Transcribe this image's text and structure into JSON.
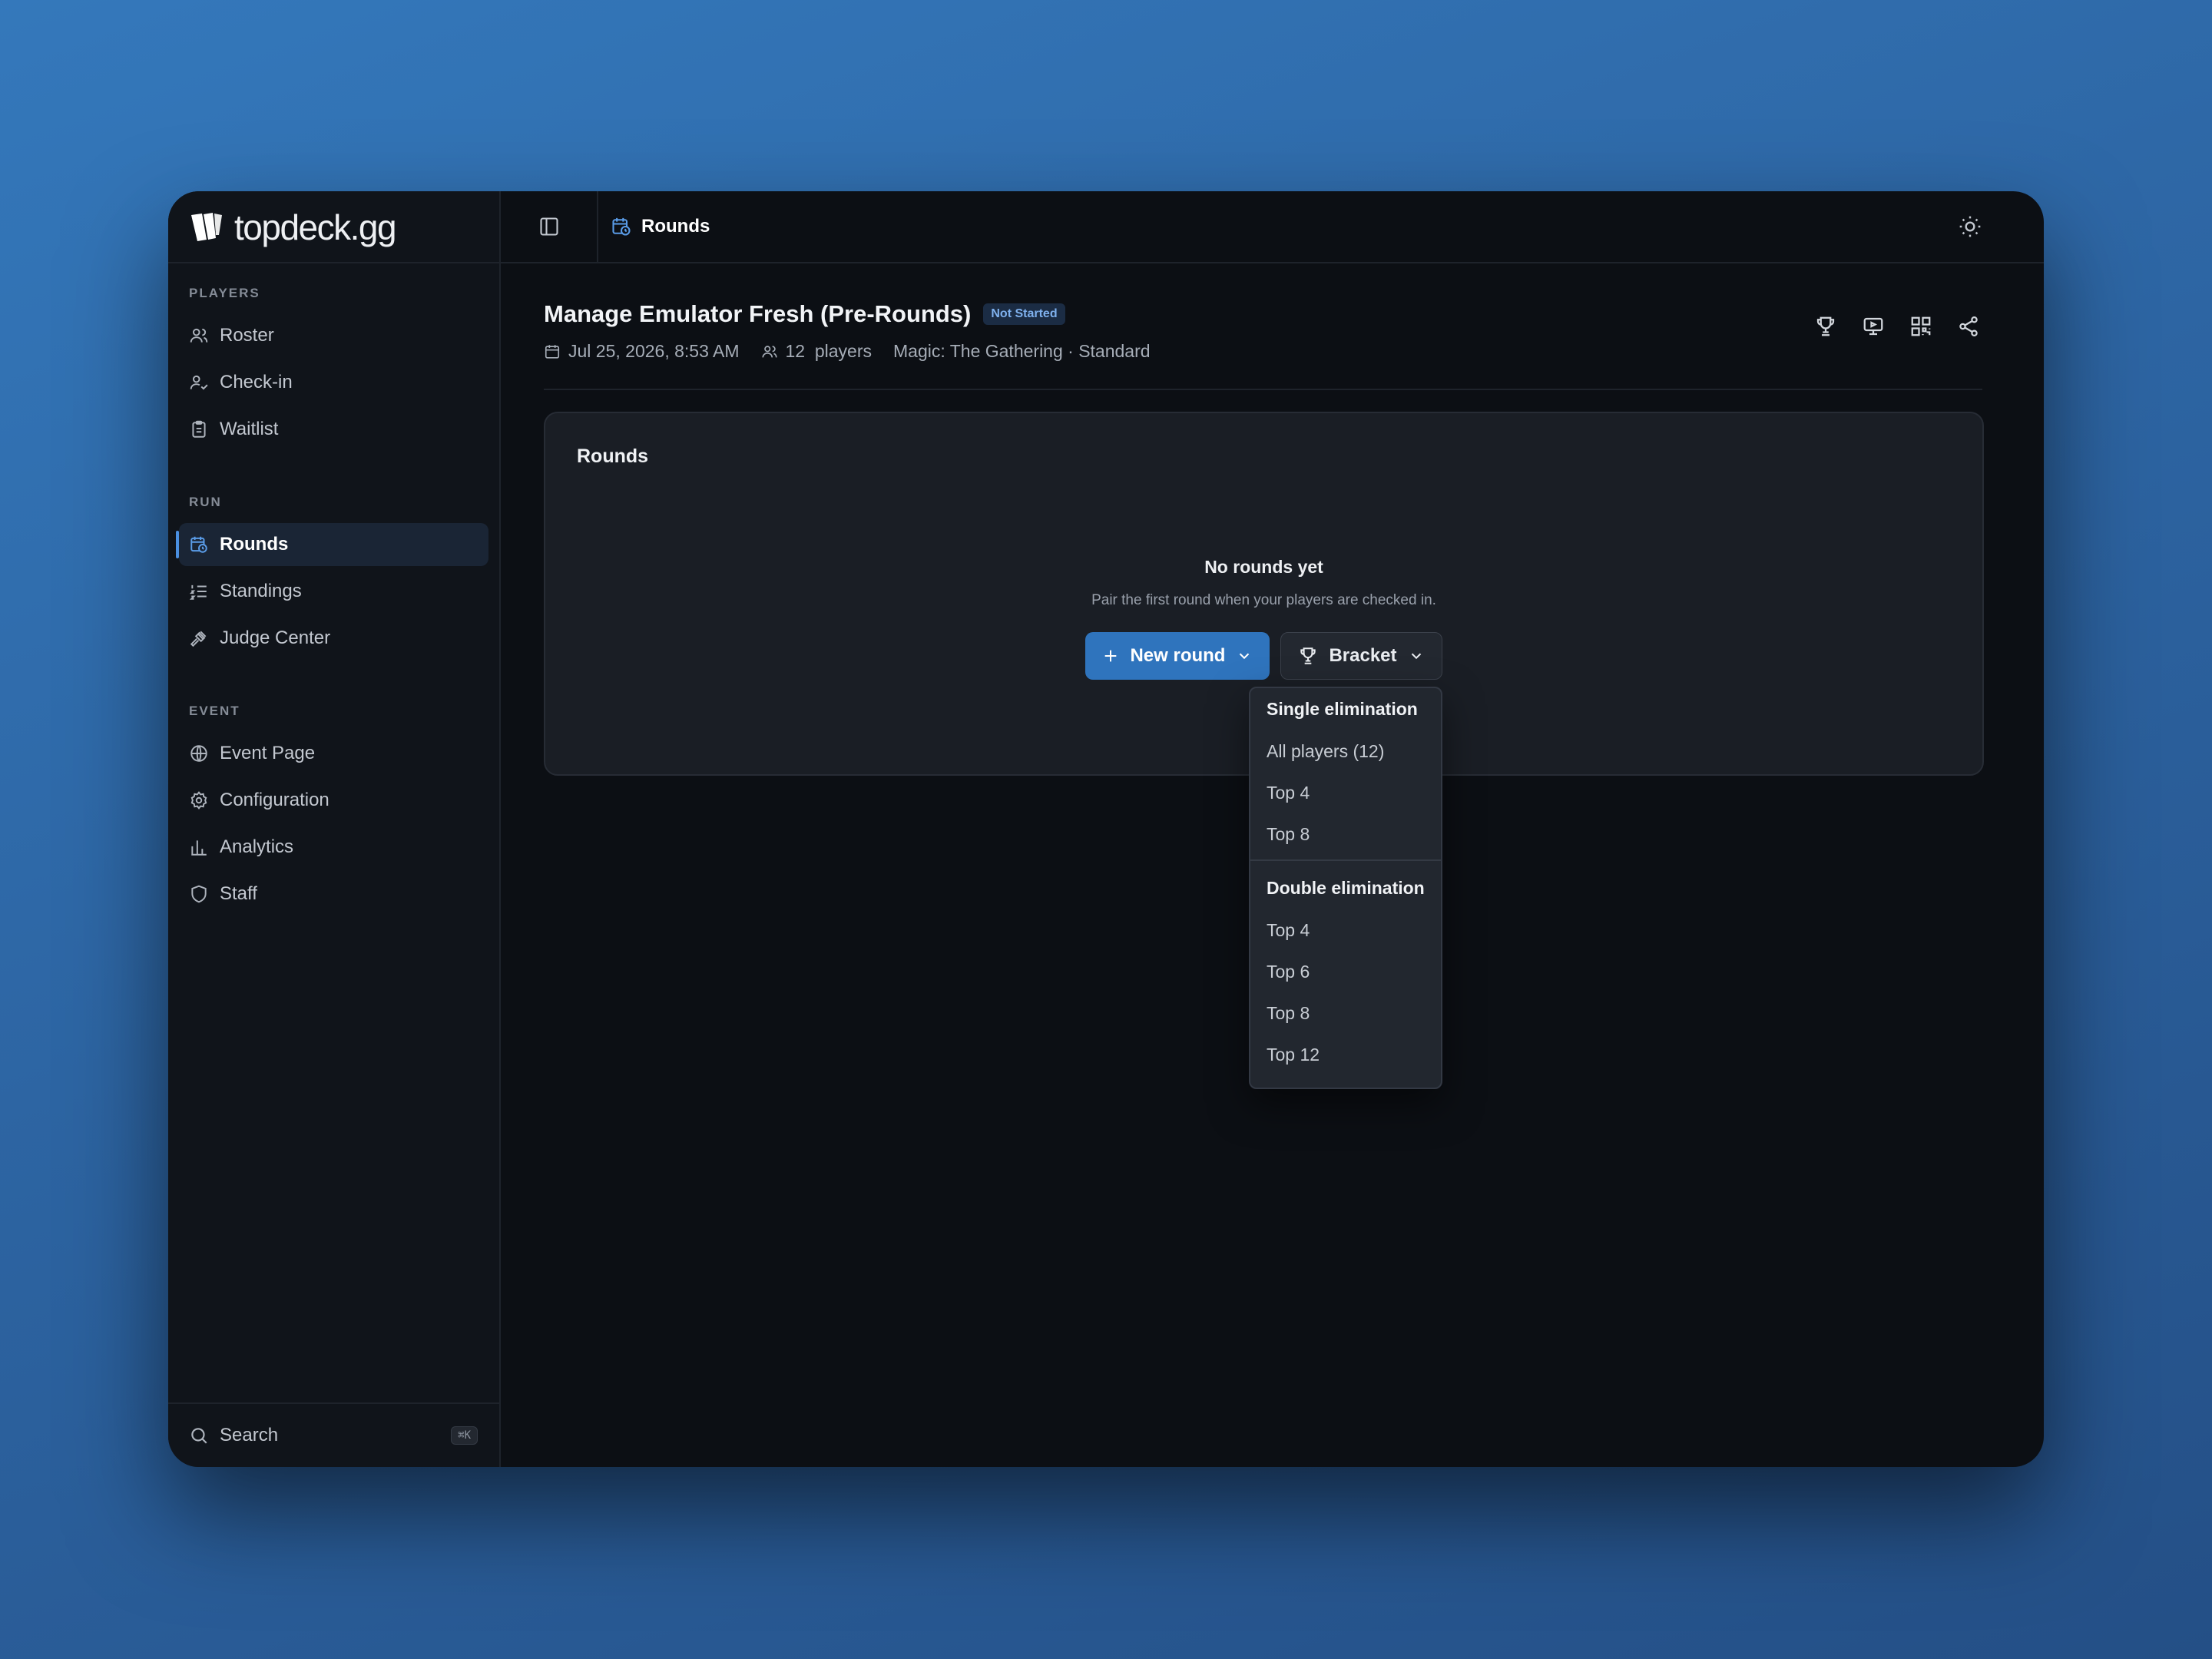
{
  "brand": {
    "name": "topdeck.gg"
  },
  "sidebar": {
    "sections": [
      {
        "label": "PLAYERS",
        "items": [
          {
            "label": "Roster",
            "icon": "users-icon"
          },
          {
            "label": "Check-in",
            "icon": "user-check-icon"
          },
          {
            "label": "Waitlist",
            "icon": "clipboard-icon"
          }
        ]
      },
      {
        "label": "RUN",
        "items": [
          {
            "label": "Rounds",
            "icon": "calendar-clock-icon",
            "active": true
          },
          {
            "label": "Standings",
            "icon": "list-ordered-icon"
          },
          {
            "label": "Judge Center",
            "icon": "gavel-icon"
          }
        ]
      },
      {
        "label": "EVENT",
        "items": [
          {
            "label": "Event Page",
            "icon": "globe-icon"
          },
          {
            "label": "Configuration",
            "icon": "gear-icon"
          },
          {
            "label": "Analytics",
            "icon": "bar-chart-icon"
          },
          {
            "label": "Staff",
            "icon": "shield-icon"
          }
        ]
      }
    ],
    "search": {
      "label": "Search",
      "shortcut": "⌘K"
    }
  },
  "header": {
    "breadcrumb": "Rounds"
  },
  "event": {
    "title": "Manage Emulator Fresh (Pre-Rounds)",
    "status": "Not Started",
    "date": "Jul 25, 2026, 8:53 AM",
    "players": "12  players",
    "game": "Magic: The Gathering · Standard"
  },
  "card": {
    "title": "Rounds",
    "empty_title": "No rounds yet",
    "empty_sub": "Pair the first round when your players are checked in.",
    "new_round_label": "New round",
    "bracket_label": "Bracket"
  },
  "dropdown": {
    "groups": [
      {
        "heading": "Single elimination",
        "items": [
          "All players (12)",
          "Top 4",
          "Top 8"
        ]
      },
      {
        "heading": "Double elimination",
        "items": [
          "Top 4",
          "Top 6",
          "Top 8",
          "Top 12"
        ]
      }
    ]
  },
  "colors": {
    "accent": "#2f74bd",
    "background": "#0c0f14",
    "badge": "#7fb1ee"
  }
}
